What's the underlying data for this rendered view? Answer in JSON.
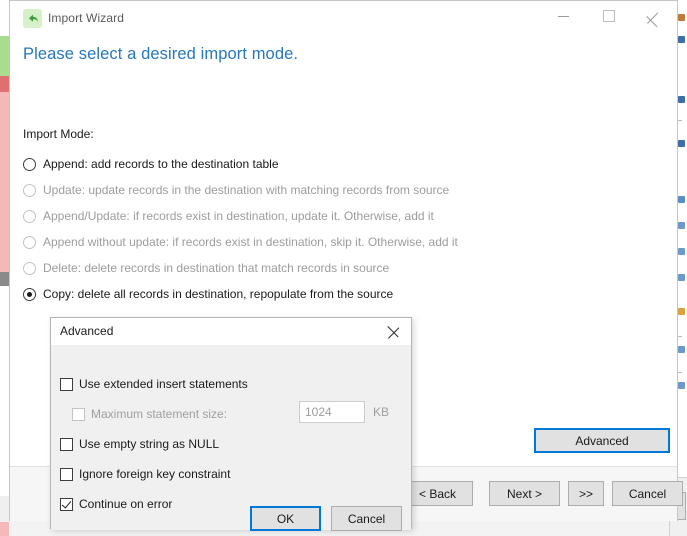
{
  "window": {
    "title": "Import Wizard",
    "icon": "back-arrow-icon",
    "controls": {
      "minimize": "minimize-icon",
      "maximize": "maximize-icon",
      "close": "close-icon"
    },
    "heading": "Please select a desired import mode.",
    "heading_color": "#2677bf"
  },
  "import_mode": {
    "label": "Import Mode:",
    "options": [
      {
        "label": "Append: add records to the destination table",
        "checked": false,
        "disabled": false
      },
      {
        "label": "Update: update records in the destination with matching records from source",
        "checked": false,
        "disabled": true
      },
      {
        "label": "Append/Update: if records exist in destination, update it. Otherwise, add it",
        "checked": false,
        "disabled": true
      },
      {
        "label": "Append without update: if records exist in destination, skip it. Otherwise, add it",
        "checked": false,
        "disabled": true
      },
      {
        "label": "Delete: delete records in destination that match records in source",
        "checked": false,
        "disabled": true
      },
      {
        "label": "Copy: delete all records in destination, repopulate from the source",
        "checked": true,
        "disabled": false
      }
    ]
  },
  "advanced_button": {
    "label": "Advanced",
    "focused": true
  },
  "footer": {
    "back": "< Back",
    "next": "Next >",
    "forward": ">>",
    "cancel": "Cancel"
  },
  "advanced_dialog": {
    "title": "Advanced",
    "close_icon": "close-icon",
    "checkboxes": [
      {
        "label": "Use extended insert statements",
        "checked": false,
        "disabled": false
      },
      {
        "label": "Maximum statement size:",
        "checked": false,
        "disabled": true
      },
      {
        "label": "Use empty string as NULL",
        "checked": false,
        "disabled": false
      },
      {
        "label": "Ignore foreign key constraint",
        "checked": false,
        "disabled": false
      },
      {
        "label": "Continue on error",
        "checked": true,
        "disabled": false
      }
    ],
    "max_statement_size": {
      "value": "1024",
      "unit": "KB",
      "disabled": true
    },
    "buttons": {
      "ok": "OK",
      "cancel": "Cancel",
      "ok_focused": true
    }
  },
  "accent": {
    "focus_border": "#0078d7",
    "selection": "#0078d7"
  }
}
